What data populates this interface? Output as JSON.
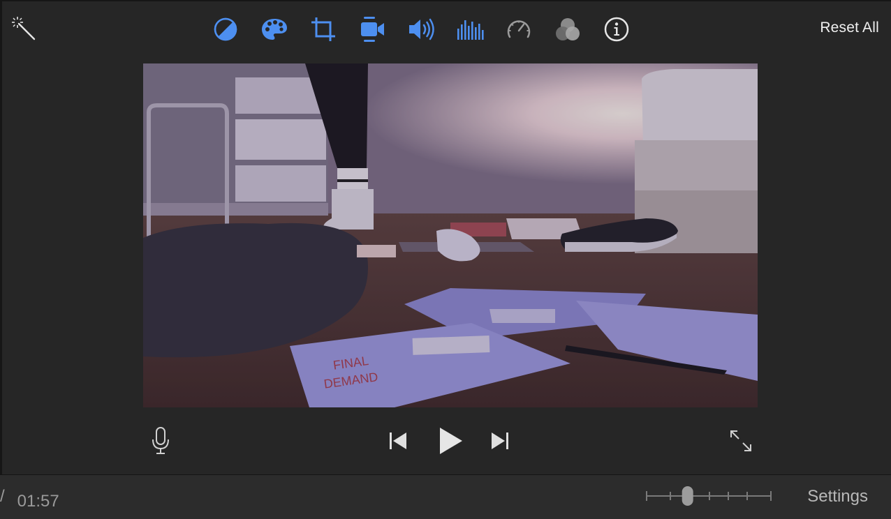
{
  "toolbar": {
    "magic_wand_icon": "magic-wand-icon",
    "tools": [
      {
        "name": "color-balance-icon",
        "color": "#4d8ff0"
      },
      {
        "name": "color-palette-icon",
        "color": "#4d8ff0"
      },
      {
        "name": "crop-icon",
        "color": "#4d8ff0"
      },
      {
        "name": "stabilization-camera-icon",
        "color": "#4d8ff0"
      },
      {
        "name": "volume-icon",
        "color": "#4d8ff0"
      },
      {
        "name": "equalizer-icon",
        "color": "#4d8ff0"
      },
      {
        "name": "speed-gauge-icon",
        "color": "#9a9a9a"
      },
      {
        "name": "filter-circles-icon",
        "color": "#9a9a9a"
      },
      {
        "name": "info-icon",
        "color": "#e6e6e6"
      }
    ],
    "reset_label": "Reset All"
  },
  "preview": {
    "envelope_text_top": "FINAL",
    "envelope_text_bottom": "DEMAND"
  },
  "playback": {
    "mic_icon": "microphone-icon",
    "prev_icon": "skip-back-icon",
    "play_icon": "play-icon",
    "next_icon": "skip-forward-icon",
    "fullscreen_icon": "fullscreen-icon"
  },
  "footer": {
    "clip_fragment": "/",
    "timecode": "01:57",
    "zoom_level": 0.33,
    "settings_label": "Settings"
  },
  "colors": {
    "accent": "#4d8ff0",
    "background": "#262626",
    "footer": "#2c2c2c"
  }
}
